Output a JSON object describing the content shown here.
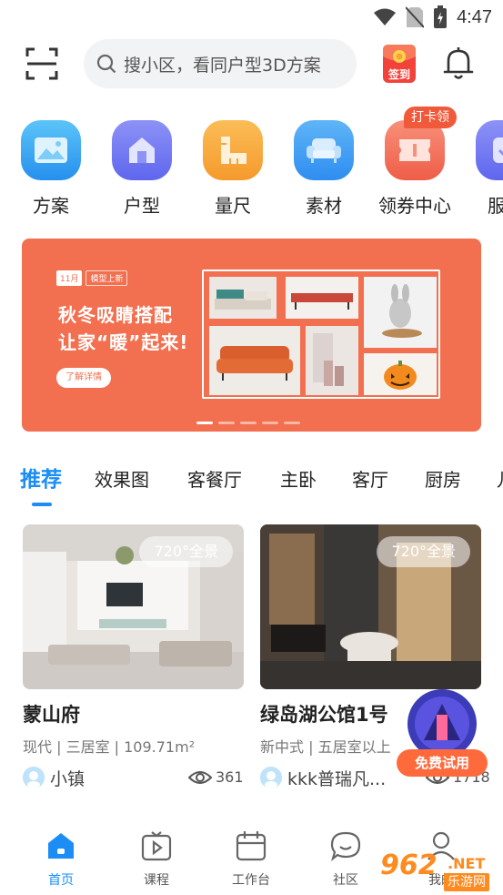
{
  "status_bar": {
    "time": "4:47"
  },
  "search": {
    "placeholder": "搜小区，看同户型3D方案",
    "signin_label": "签到"
  },
  "quick_badge": "打卡领",
  "quick_items": [
    {
      "label": "方案",
      "icon": "picture-icon",
      "color": "#2fa3f0"
    },
    {
      "label": "户型",
      "icon": "house-icon",
      "color": "#6f78f2"
    },
    {
      "label": "量尺",
      "icon": "ruler-icon",
      "color": "#f7a23a"
    },
    {
      "label": "素材",
      "icon": "sofa-icon",
      "color": "#3b9bf0"
    },
    {
      "label": "领券中心",
      "icon": "coupon-icon",
      "color": "#f26b52"
    },
    {
      "label": "服务",
      "icon": "service-icon",
      "color": "#6f78f2"
    }
  ],
  "banner": {
    "chip_month": "11月",
    "chip_tag": "模型上新",
    "title_line1": "秋冬吸睛搭配",
    "title_line2": "让家“暖”起来!",
    "cta": "了解详情",
    "background": "#f26f4f",
    "page_count": 5,
    "active_page": 1
  },
  "tabs": [
    "推荐",
    "效果图",
    "客餐厅",
    "主卧",
    "客厅",
    "厨房",
    "儿"
  ],
  "active_tab": 0,
  "cards": [
    {
      "badge": "720°全景",
      "title": "蒙山府",
      "meta": "现代 | 三居室 | 109.71m²",
      "author": "小镇",
      "views": "361"
    },
    {
      "badge": "720°全景",
      "title": "绿岛湖公馆1号",
      "meta": "新中式 | 五居室以上",
      "author": "kkk普瑞凡...",
      "views": "1718"
    }
  ],
  "promo": {
    "label": "免费试用"
  },
  "bottom_nav": [
    {
      "label": "首页",
      "icon": "home-icon",
      "active": true
    },
    {
      "label": "课程",
      "icon": "video-icon",
      "active": false
    },
    {
      "label": "工作台",
      "icon": "calendar-icon",
      "active": false
    },
    {
      "label": "社区",
      "icon": "chat-icon",
      "active": false
    },
    {
      "label": "我的",
      "icon": "profile-icon",
      "active": false
    }
  ],
  "watermark": {
    "number": "962",
    "suffix": ".NET",
    "site": "乐游网"
  },
  "colors": {
    "accent": "#1b8df5",
    "promo": "#ff6a3d"
  }
}
